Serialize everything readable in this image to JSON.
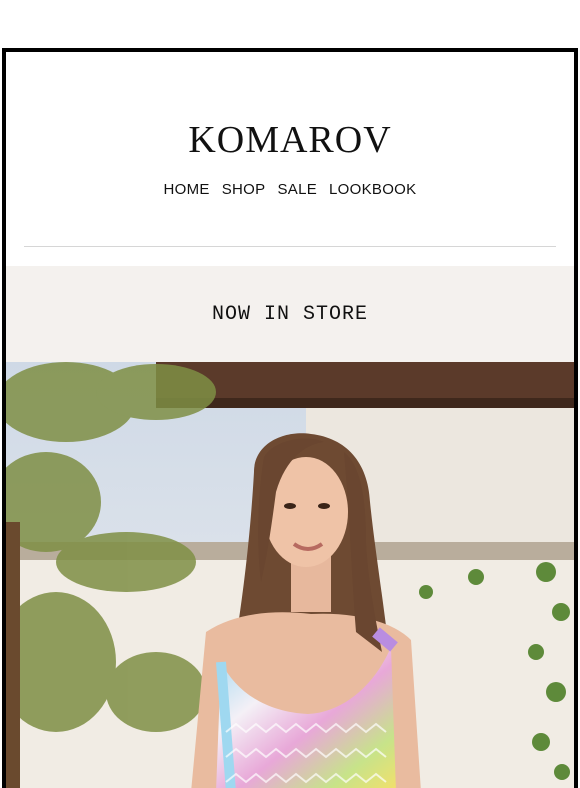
{
  "brand": {
    "logo": "KOMAROV"
  },
  "nav": {
    "home": "HOME",
    "shop": "SHOP",
    "sale": "SALE",
    "lookbook": "LOOKBOOK"
  },
  "banner": {
    "text": "NOW IN STORE"
  },
  "hero": {
    "image": "model-in-colorful-dress-photo"
  },
  "colors": {
    "banner_bg": "#f4f1ee",
    "frame": "#000000",
    "text": "#111111"
  }
}
